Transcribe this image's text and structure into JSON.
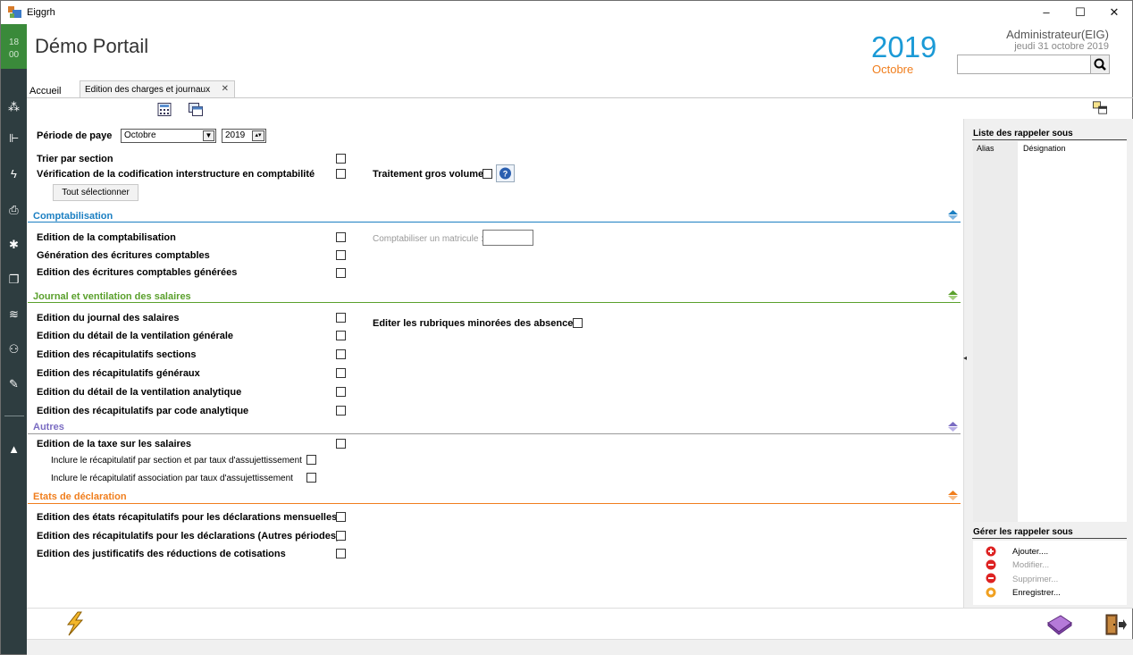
{
  "window": {
    "title": "Eiggrh",
    "minimize": "–",
    "maximize": "☐",
    "close": "✕"
  },
  "clock": {
    "hour": "18",
    "minute": "00"
  },
  "header": {
    "title": "Démo Portail",
    "year": "2019",
    "month": "Octobre",
    "user": "Administrateur(EIG)",
    "date": "jeudi 31 octobre 2019"
  },
  "search": {
    "value": ""
  },
  "tabs": {
    "home": "Accueil",
    "active": "Edition des charges et journaux",
    "close": "✕"
  },
  "periode": {
    "label": "Période de paye",
    "month_value": "Octobre",
    "year_value": "2019"
  },
  "options": {
    "trier": "Trier par section",
    "verif": "Vérification de la codification interstructure en comptabilité",
    "gros_volume": "Traitement gros volume",
    "select_all": "Tout sélectionner"
  },
  "sections": {
    "compta": {
      "title": "Comptabilisation",
      "items": [
        "Edition de la comptabilisation",
        "Génération des écritures comptables",
        "Edition des écritures comptables générées"
      ],
      "matricule_label": "Comptabiliser un matricule :",
      "matricule_value": ""
    },
    "journal": {
      "title": "Journal et ventilation des salaires",
      "items": [
        "Edition du journal des salaires",
        "Edition du détail de la ventilation générale",
        "Edition des récapitulatifs sections",
        "Edition des récapitulatifs généraux",
        "Edition du détail de la ventilation analytique",
        "Edition des récapitulatifs par code analytique"
      ],
      "rubriques": "Editer les rubriques minorées des absences"
    },
    "autres": {
      "title": "Autres",
      "item": "Edition de la taxe sur les salaires",
      "sub1": "Inclure le récapitulatif par section et par taux d'assujettissement",
      "sub2": "Inclure le récapitulatif association par taux d'assujettissement"
    },
    "etats": {
      "title": "Etats de déclaration",
      "items": [
        "Edition des états récapitulatifs pour les déclarations mensuelles",
        "Edition des récapitulatifs  pour les déclarations (Autres périodes)",
        "Edition des justificatifs des réductions de cotisations"
      ]
    }
  },
  "rappel": {
    "list_title": "Liste des rappeler sous",
    "col_alias": "Alias",
    "col_designation": "Désignation",
    "manage_title": "Gérer les rappeler sous",
    "actions": [
      "Ajouter....",
      "Modifier...",
      "Supprimer...",
      "Enregistrer..."
    ]
  },
  "colors": {
    "compta": "#1b7fc2",
    "journal": "#5aa02c",
    "autres": "#7a6cc2",
    "etats": "#f07e1d",
    "sidebar": "#2e3d40"
  }
}
